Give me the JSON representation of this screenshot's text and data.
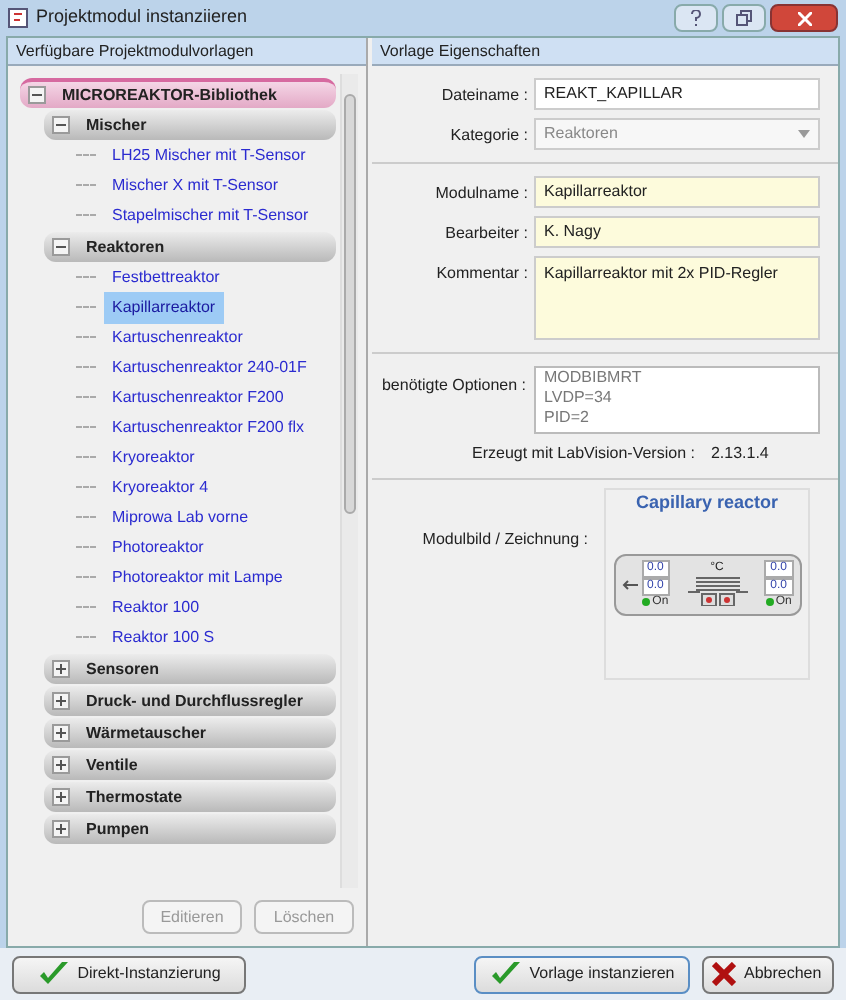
{
  "window": {
    "title": "Projektmodul instanziieren"
  },
  "left_panel": {
    "header": "Verfügbare Projektmodulvorlagen",
    "tree": {
      "label": "MICROREAKTOR-Bibliothek",
      "expanded": true,
      "children": [
        {
          "label": "Mischer",
          "expanded": true,
          "children": [
            {
              "label": "LH25 Mischer mit T-Sensor",
              "selected": false
            },
            {
              "label": "Mischer X mit T-Sensor",
              "selected": false
            },
            {
              "label": "Stapelmischer mit T-Sensor",
              "selected": false
            }
          ]
        },
        {
          "label": "Reaktoren",
          "expanded": true,
          "children": [
            {
              "label": "Festbettreaktor",
              "selected": false
            },
            {
              "label": "Kapillarreaktor",
              "selected": true
            },
            {
              "label": "Kartuschenreaktor",
              "selected": false
            },
            {
              "label": "Kartuschenreaktor 240-01F",
              "selected": false
            },
            {
              "label": "Kartuschenreaktor F200",
              "selected": false
            },
            {
              "label": "Kartuschenreaktor F200 flx",
              "selected": false
            },
            {
              "label": "Kryoreaktor",
              "selected": false
            },
            {
              "label": "Kryoreaktor 4",
              "selected": false
            },
            {
              "label": "Miprowa Lab vorne",
              "selected": false
            },
            {
              "label": "Photoreaktor",
              "selected": false
            },
            {
              "label": "Photoreaktor mit Lampe",
              "selected": false
            },
            {
              "label": "Reaktor 100",
              "selected": false
            },
            {
              "label": "Reaktor 100 S",
              "selected": false
            }
          ]
        },
        {
          "label": "Sensoren",
          "expanded": false
        },
        {
          "label": "Druck- und Durchflussregler",
          "expanded": false
        },
        {
          "label": "Wärmetauscher",
          "expanded": false
        },
        {
          "label": "Ventile",
          "expanded": false
        },
        {
          "label": "Thermostate",
          "expanded": false
        },
        {
          "label": "Pumpen",
          "expanded": false
        }
      ]
    },
    "buttons": [
      {
        "label": "Editieren",
        "disabled": true
      },
      {
        "label": "Löschen",
        "disabled": true
      }
    ]
  },
  "right_panel": {
    "header": "Vorlage Eigenschaften",
    "fields": [
      {
        "label": "Dateiname :",
        "value": "REAKT_KAPILLAR",
        "kind": "text"
      },
      {
        "label": "Kategorie :",
        "value": "Reaktoren",
        "kind": "dropdown"
      },
      {
        "label": "Modulname :",
        "value": "Kapillarreaktor",
        "kind": "text"
      },
      {
        "label": "Bearbeiter :",
        "value": "K. Nagy",
        "kind": "text"
      },
      {
        "label": "Kommentar :",
        "value": "Kapillarreaktor mit 2x PID-Regler",
        "kind": "area"
      }
    ],
    "options": {
      "label": "benötigte Optionen :",
      "lines": [
        "MODBIBMRT",
        "LVDP=34",
        "PID=2"
      ]
    },
    "version": {
      "label": "Erzeugt mit LabVision-Version :",
      "value": "2.13.1.4"
    },
    "module_image": {
      "label": "Modulbild / Zeichnung :",
      "title": "Capillary reactor",
      "unit": "°C",
      "left_values": [
        "0.0",
        "0.0"
      ],
      "left_status": "On",
      "right_values": [
        "0.0",
        "0.0"
      ],
      "right_status": "On"
    }
  },
  "footer": {
    "buttons": [
      {
        "label": "Direkt-Instanzierung",
        "kind": "ok"
      },
      {
        "label": "Vorlage instanzieren",
        "kind": "ok"
      },
      {
        "label": "Abbrechen",
        "kind": "cancel"
      }
    ]
  }
}
